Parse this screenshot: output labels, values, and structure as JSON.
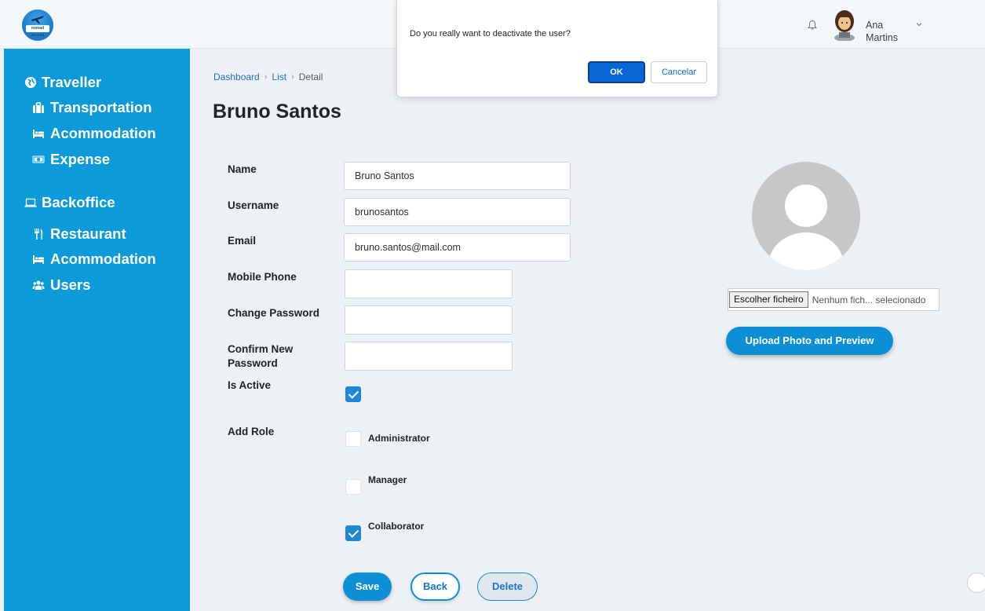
{
  "header": {
    "logo_text": "nomad abroad",
    "user_first": "Ana",
    "user_last": "Martins"
  },
  "sidebar": {
    "sections": [
      {
        "label": "Traveller",
        "icon": "globe-icon",
        "items": [
          {
            "label": "Transportation",
            "icon": "suitcase-icon"
          },
          {
            "label": "Acommodation",
            "icon": "bed-icon"
          },
          {
            "label": "Expense",
            "icon": "money-icon"
          }
        ]
      },
      {
        "label": "Backoffice",
        "icon": "laptop-icon",
        "items": [
          {
            "label": "Restaurant",
            "icon": "utensils-icon"
          },
          {
            "label": "Acommodation",
            "icon": "bed-icon"
          },
          {
            "label": "Users",
            "icon": "users-icon"
          }
        ]
      }
    ],
    "color": "#0d9ad8"
  },
  "dialog": {
    "message": "Do you really want to deactivate the user?",
    "ok_label": "OK",
    "cancel_label": "Cancelar"
  },
  "breadcrumb": {
    "items": [
      "Dashboard",
      "List",
      "Detail"
    ]
  },
  "page_title": "Bruno Santos",
  "form": {
    "name_label": "Name",
    "name_value": "Bruno Santos",
    "username_label": "Username",
    "username_value": "brunosantos",
    "email_label": "Email",
    "email_value": "bruno.santos@mail.com",
    "mobile_label": "Mobile Phone",
    "mobile_value": "",
    "password_label": "Change Password",
    "confirm_label_line1": "Confirm New",
    "confirm_label_line2": "Password",
    "active_label": "Is Active",
    "is_active": true,
    "roles_label": "Add Role",
    "roles": [
      {
        "label": "Administrator",
        "checked": false
      },
      {
        "label": "Manager",
        "checked": false
      },
      {
        "label": "Collaborator",
        "checked": true
      }
    ],
    "save_label": "Save",
    "back_label": "Back",
    "delete_label": "Delete"
  },
  "photo": {
    "file_button": "Escolher ficheiro",
    "file_status": "Nenhum fich... selecionado",
    "upload_label": "Upload Photo and Preview"
  },
  "colors": {
    "accent": "#0d8fd6",
    "ok_button": "#0a66d6"
  }
}
